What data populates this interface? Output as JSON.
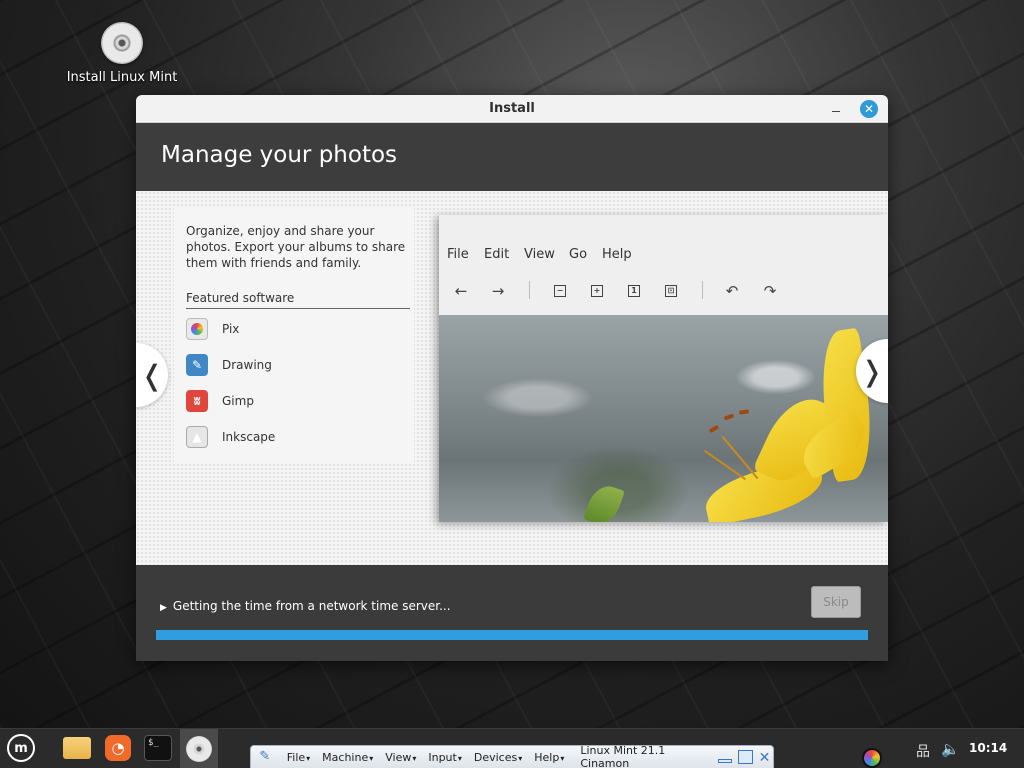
{
  "desktop": {
    "icon_label": "Install Linux Mint"
  },
  "window": {
    "title": "Install",
    "slide_title": "Manage your photos",
    "description": "Organize, enjoy and share your photos. Export your albums to share them with friends and family.",
    "featured_label": "Featured software",
    "apps": [
      {
        "name": "Pix",
        "icon": "pix-icon"
      },
      {
        "name": "Drawing",
        "icon": "drawing-icon"
      },
      {
        "name": "Gimp",
        "icon": "gimp-icon"
      },
      {
        "name": "Inkscape",
        "icon": "inkscape-icon"
      }
    ],
    "screenshot_menu": [
      "File",
      "Edit",
      "View",
      "Go",
      "Help"
    ],
    "status_text": "Getting the time from a network time server...",
    "skip_label": "Skip",
    "progress_fraction": 1.0
  },
  "taskbar": {
    "vbox_menu": [
      "File",
      "Machine",
      "View",
      "Input",
      "Devices",
      "Help"
    ],
    "vbox_title": "Linux Mint 21.1 Cinamon",
    "clock": "10:14"
  },
  "colors": {
    "accent": "#2f9de0",
    "header_bg": "#3d3d3d"
  }
}
